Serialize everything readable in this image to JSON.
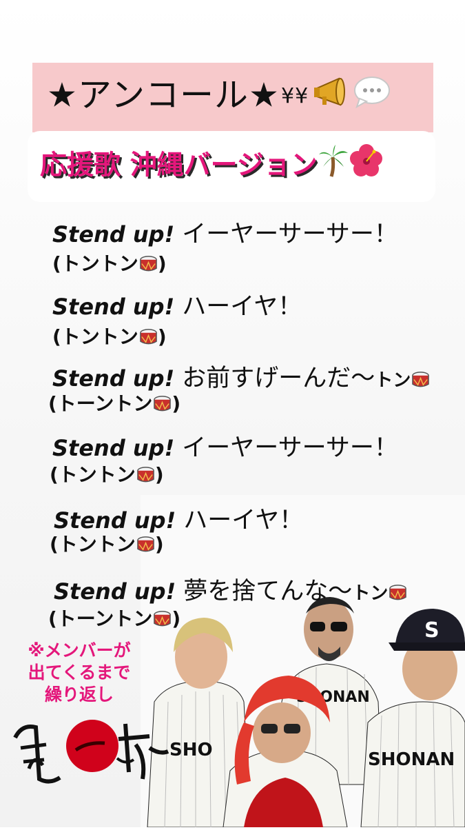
{
  "header": {
    "title": "★アンコール★",
    "title_emojis": [
      "money-mouth",
      "megaphone-icon",
      "speech-bubble-icon"
    ],
    "subtitle": "応援歌 沖縄バージョン",
    "subtitle_emojis": [
      "palm-tree-icon",
      "hibiscus-icon"
    ]
  },
  "lyrics": [
    {
      "en": "Stend up!",
      "jp": "イーヤーサーサー！",
      "tail": "",
      "paren": "(トントン",
      "paren_end": ")"
    },
    {
      "en": "Stend up!",
      "jp": "ハーイヤ！",
      "tail": "",
      "paren": "(トントン",
      "paren_end": ")"
    },
    {
      "en": "Stend up!",
      "jp": "お前すげーんだ〜",
      "tail": "トン",
      "paren": "(トーントン",
      "paren_end": ")"
    },
    {
      "en": "Stend up!",
      "jp": "イーヤーサーサー！",
      "tail": "",
      "paren": "(トントン",
      "paren_end": ")"
    },
    {
      "en": "Stend up!",
      "jp": "ハーイヤ！",
      "tail": "",
      "paren": "(トントン",
      "paren_end": ")"
    },
    {
      "en": "Stend up!",
      "jp": "夢を捨てんな～",
      "tail": "トン",
      "paren": "(トーントン",
      "paren_end": ")"
    }
  ],
  "note": {
    "line1": "※メンバーが",
    "line2": "出てくるまで",
    "line3": "繰り返し"
  },
  "photo": {
    "jersey_text": "SHONAN",
    "cap_letter": "S"
  },
  "colors": {
    "title_bg": "#f7c9cb",
    "accent_pink": "#e4177b",
    "logo_red": "#d0021b"
  }
}
